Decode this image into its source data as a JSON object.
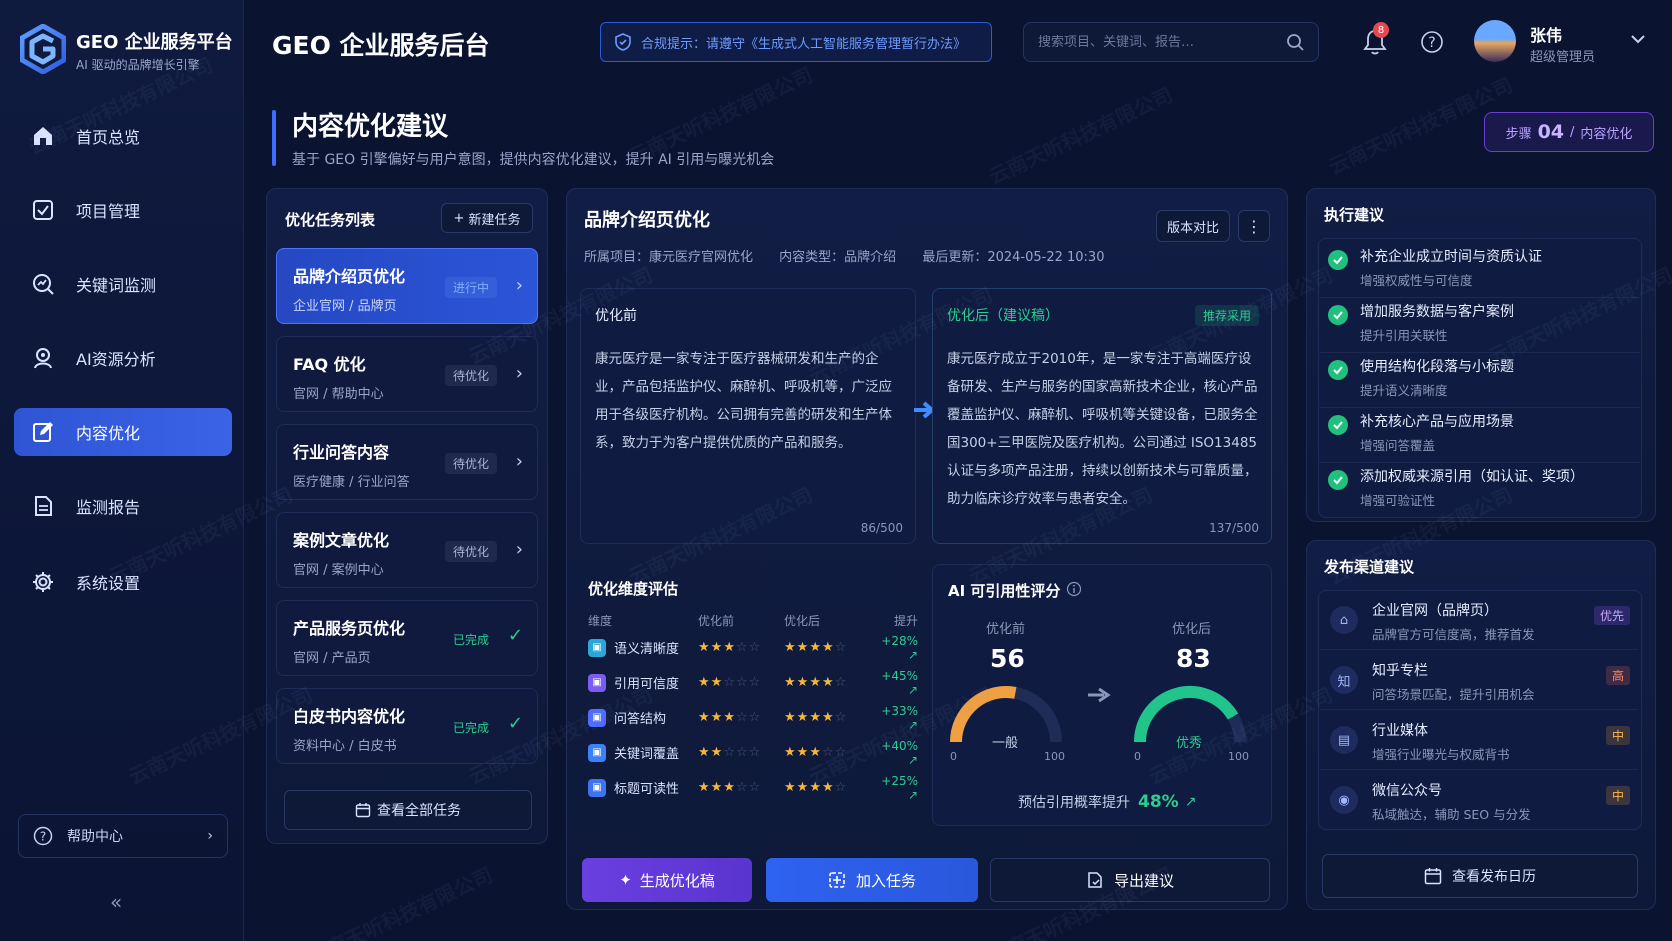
{
  "brand": {
    "title": "GEO 企业服务平台",
    "subtitle": "AI 驱动的品牌增长引擎"
  },
  "sidebar": {
    "items": [
      {
        "label": "首页总览",
        "icon": "home-icon"
      },
      {
        "label": "项目管理",
        "icon": "checklist-icon"
      },
      {
        "label": "关键词监测",
        "icon": "search-chart-icon"
      },
      {
        "label": "AI资源分析",
        "icon": "ai-analysis-icon"
      },
      {
        "label": "内容优化",
        "icon": "edit-icon"
      },
      {
        "label": "监测报告",
        "icon": "report-icon"
      },
      {
        "label": "系统设置",
        "icon": "gear-icon"
      }
    ],
    "active_index": 4,
    "help_label": "帮助中心",
    "collapse_glyph": "«"
  },
  "header": {
    "title": "GEO 企业服务后台",
    "compliance_text": "合规提示：请遵守《生成式人工智能服务管理暂行办法》",
    "search_placeholder": "搜索项目、关键词、报告…",
    "notification_count": "8",
    "user_name": "张伟",
    "user_role": "超级管理员"
  },
  "page": {
    "title": "内容优化建议",
    "description": "基于 GEO 引擎偏好与用户意图，提供内容优化建议，提升 AI 引用与曝光机会",
    "step_prefix": "步骤",
    "step_num": "04",
    "step_sep": "/",
    "step_label": "内容优化"
  },
  "tasks": {
    "title": "优化任务列表",
    "new_label": "新建任务",
    "items": [
      {
        "name": "品牌介绍页优化",
        "sub": "企业官网 / 品牌页",
        "status": "进行中",
        "state": "doing"
      },
      {
        "name": "FAQ 优化",
        "sub": "官网 / 帮助中心",
        "status": "待优化",
        "state": "todo"
      },
      {
        "name": "行业问答内容",
        "sub": "医疗健康 / 行业问答",
        "status": "待优化",
        "state": "todo"
      },
      {
        "name": "案例文章优化",
        "sub": "官网 / 案例中心",
        "status": "待优化",
        "state": "todo"
      },
      {
        "name": "产品服务页优化",
        "sub": "官网 / 产品页",
        "status": "已完成",
        "state": "done"
      },
      {
        "name": "白皮书内容优化",
        "sub": "资料中心 / 白皮书",
        "status": "已完成",
        "state": "done"
      }
    ],
    "view_all_label": "查看全部任务"
  },
  "detail": {
    "title": "品牌介绍页优化",
    "compare_label": "版本对比",
    "meta": {
      "project": "所属项目：康元医疗官网优化",
      "type": "内容类型：品牌介绍",
      "updated": "最后更新：2024-05-22 10:30"
    },
    "before": {
      "label": "优化前",
      "text": "康元医疗是一家专注于医疗器械研发和生产的企业，产品包括监护仪、麻醉机、呼吸机等，广泛应用于各级医疗机构。公司拥有完善的研发和生产体系，致力于为客户提供优质的产品和服务。",
      "count": "86/500"
    },
    "after": {
      "label": "优化后（建议稿）",
      "tag": "推荐采用",
      "text": "康元医疗成立于2010年，是一家专注于高端医疗设备研发、生产与服务的国家高新技术企业，核心产品覆盖监护仪、麻醉机、呼吸机等关键设备，已服务全国300+三甲医院及医疗机构。公司通过 ISO13485 认证与多项产品注册，持续以创新技术与可靠质量，助力临床诊疗效率与患者安全。",
      "count": "137/500"
    }
  },
  "evaluation": {
    "title": "优化维度评估",
    "headers": [
      "维度",
      "优化前",
      "优化后",
      "提升"
    ],
    "rows": [
      {
        "name": "语义清晰度",
        "before": 3,
        "after": 4,
        "up": "+28% ↗",
        "color": "#2aa7d8"
      },
      {
        "name": "引用可信度",
        "before": 2,
        "after": 4,
        "up": "+45% ↗",
        "color": "#7a5cf0"
      },
      {
        "name": "问答结构",
        "before": 3,
        "after": 4,
        "up": "+33% ↗",
        "color": "#4d6bff"
      },
      {
        "name": "关键词覆盖",
        "before": 2,
        "after": 3,
        "up": "+40% ↗",
        "color": "#3b82f6"
      },
      {
        "name": "标题可读性",
        "before": 3,
        "after": 4,
        "up": "+25% ↗",
        "color": "#3f74f0"
      }
    ]
  },
  "ai_score": {
    "title": "AI 可引用性评分",
    "before_label": "优化前",
    "before_value": 56,
    "before_grade": "一般",
    "after_label": "优化后",
    "after_value": 83,
    "after_grade": "优秀",
    "min": "0",
    "max": "100",
    "forecast_label": "预估引用概率提升",
    "forecast_value": "48%",
    "forecast_arrow": "↗"
  },
  "actions": {
    "generate": "生成优化稿",
    "add_task": "加入任务",
    "export": "导出建议"
  },
  "exec_suggestions": {
    "title": "执行建议",
    "items": [
      {
        "title": "补充企业成立时间与资质认证",
        "sub": "增强权威性与可信度"
      },
      {
        "title": "增加服务数据与客户案例",
        "sub": "提升引用关联性"
      },
      {
        "title": "使用结构化段落与小标题",
        "sub": "提升语义清晰度"
      },
      {
        "title": "补充核心产品与应用场景",
        "sub": "增强问答覆盖"
      },
      {
        "title": "添加权威来源引用（如认证、奖项）",
        "sub": "增强可验证性"
      }
    ]
  },
  "channels": {
    "title": "发布渠道建议",
    "items": [
      {
        "title": "企业官网（品牌页）",
        "sub": "品牌官方可信度高，推荐首发",
        "tag": "优先",
        "tag_color": "purple",
        "icon": "building-icon"
      },
      {
        "title": "知乎专栏",
        "sub": "问答场景匹配，提升引用机会",
        "tag": "高",
        "tag_color": "red",
        "icon": "zhihu-icon"
      },
      {
        "title": "行业媒体",
        "sub": "增强行业曝光与权威背书",
        "tag": "中",
        "tag_color": "orange",
        "icon": "media-icon"
      },
      {
        "title": "微信公众号",
        "sub": "私域触达，辅助 SEO 与分发",
        "tag": "中",
        "tag_color": "orange",
        "icon": "wechat-icon"
      }
    ],
    "calendar_label": "查看发布日历"
  },
  "watermark": "云南天听科技有限公司"
}
